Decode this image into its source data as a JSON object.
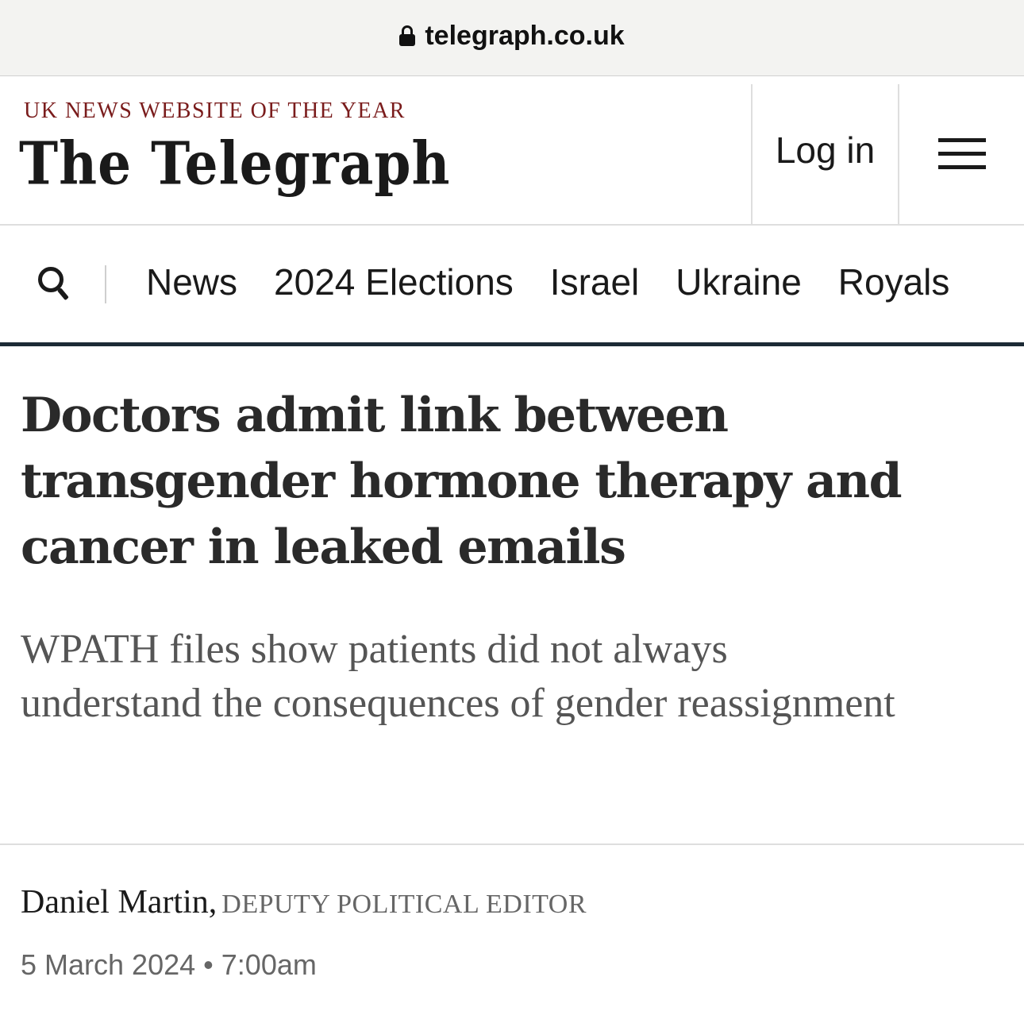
{
  "browser": {
    "url": "telegraph.co.uk"
  },
  "header": {
    "kicker": "UK NEWS WEBSITE OF THE YEAR",
    "logo": "The Telegraph",
    "login_label": "Log in"
  },
  "nav": {
    "items": [
      {
        "label": "News"
      },
      {
        "label": "2024 Elections"
      },
      {
        "label": "Israel"
      },
      {
        "label": "Ukraine"
      },
      {
        "label": "Royals"
      }
    ]
  },
  "article": {
    "headline": "Doctors admit link between transgender hormone therapy and cancer in leaked emails",
    "standfirst": "WPATH files show patients did not always understand the consequences of gender reassignment",
    "author": "Daniel Martin,",
    "author_role": "DEPUTY POLITICAL EDITOR",
    "date": "5 March 2024",
    "separator": "•",
    "time": "7:00am"
  },
  "colors": {
    "kicker": "#7a1c1c",
    "nav_rule": "#1c2a35",
    "text": "#1a1a1a",
    "muted": "#555555"
  },
  "icons": [
    "lock-icon",
    "menu-icon",
    "search-icon"
  ]
}
